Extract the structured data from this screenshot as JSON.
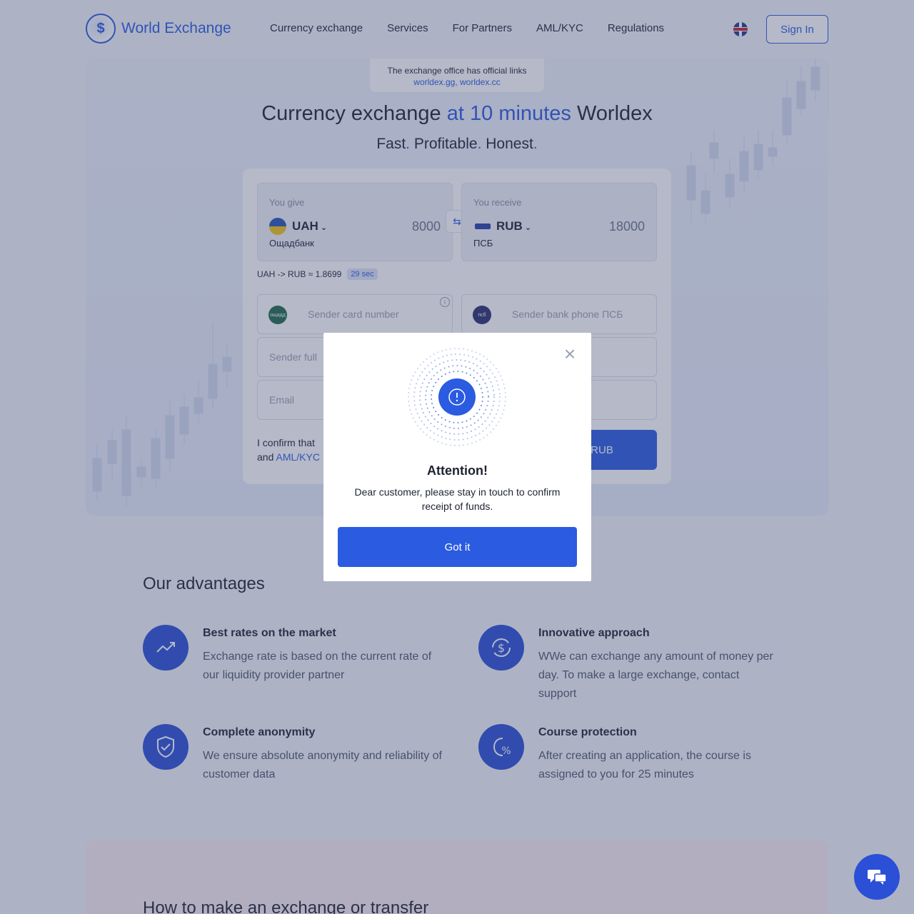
{
  "header": {
    "brand": "World Exchange",
    "nav": [
      "Currency exchange",
      "Services",
      "For Partners",
      "AML/KYC",
      "Regulations"
    ],
    "language_icon": "uk-flag-icon",
    "signin_label": "Sign In"
  },
  "hero": {
    "notice_line1": "The exchange office has official links",
    "notice_links": "worldex.gg, worldex.cc",
    "title_part1": "Currency exchange",
    "title_accent": "at 10 minutes",
    "title_part2": "Worldex",
    "subtitle_words": [
      "Fast",
      "Profitable",
      "Honest"
    ],
    "subtitle_dot": "."
  },
  "form": {
    "give": {
      "label": "You give",
      "currency": "UAH",
      "amount": "8000",
      "bank": "Ощадбанк"
    },
    "receive": {
      "label": "You receive",
      "currency": "RUB",
      "amount": "18000",
      "bank": "ПСБ"
    },
    "rate_text": "UAH -> RUB ≈ 1.8699",
    "timer": "29 sec",
    "card_placeholder": "Sender card number",
    "phone_placeholder": "Sender bank phone ПСБ",
    "name_placeholder": "Sender full",
    "email_placeholder": "Email",
    "confirm_text": "I confirm that",
    "confirm_and": "and",
    "aml_link": "AML/KYC",
    "submit_label": "RUB",
    "give_bank_badge": "ощадд",
    "recv_bank_badge": "псб"
  },
  "advantages": {
    "title": "Our advantages",
    "items": [
      {
        "title": "Best rates on the market",
        "desc": "Exchange rate is based on the current rate of our liquidity provider partner",
        "icon": "trend-up-icon"
      },
      {
        "title": "Innovative approach",
        "desc": "WWe can exchange any amount of money per day. To make a large exchange, contact support",
        "icon": "dollar-cycle-icon"
      },
      {
        "title": "Complete anonymity",
        "desc": "We ensure absolute anonymity and reliability of customer data",
        "icon": "shield-check-icon"
      },
      {
        "title": "Course protection",
        "desc": "After creating an application, the course is assigned to you for 25 minutes",
        "icon": "percent-clock-icon"
      }
    ]
  },
  "how": {
    "title": "How to make an exchange or transfer"
  },
  "modal": {
    "title": "Attention!",
    "text": "Dear customer, please stay in touch to confirm receipt of funds.",
    "button_label": "Got it",
    "icon": "exclamation-icon"
  },
  "colors": {
    "accent": "#2b5be0",
    "overlay": "rgba(60,70,110,0.38)"
  }
}
